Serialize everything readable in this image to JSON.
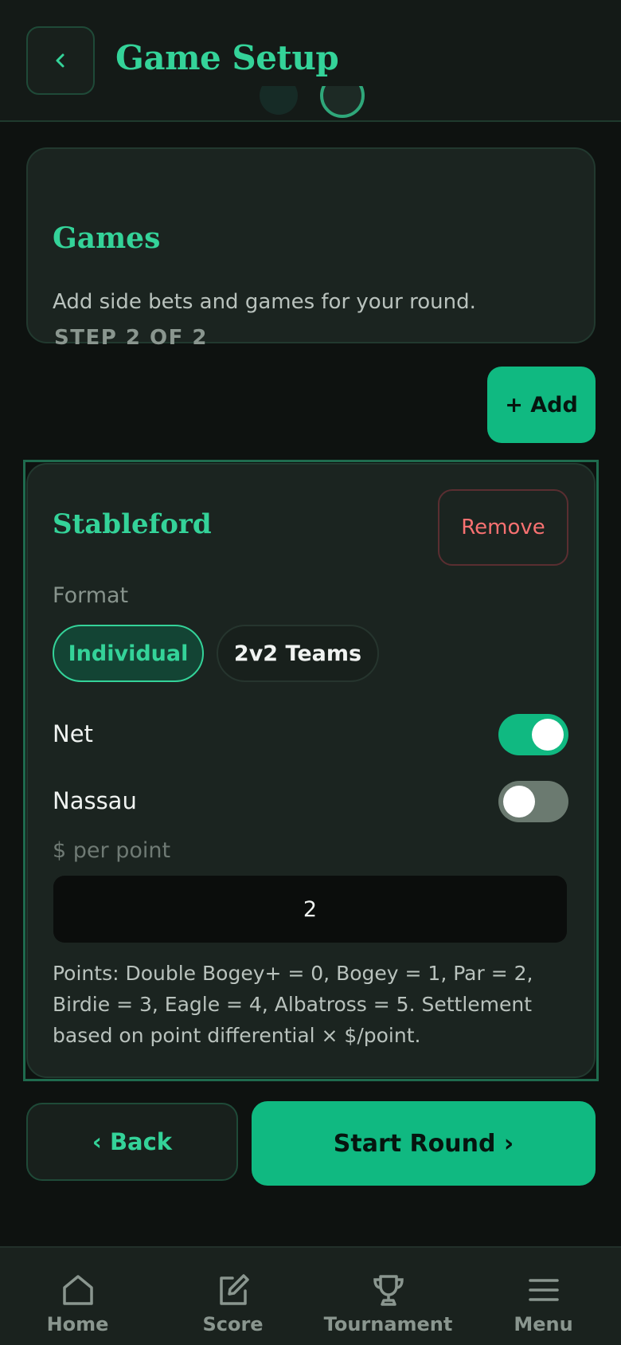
{
  "header": {
    "title": "Game Setup"
  },
  "step": {
    "label": "STEP 2 OF 2",
    "title": "Games",
    "description": "Add side bets and games for your round."
  },
  "add_button": "+ Add",
  "game": {
    "title": "Stableford",
    "remove_label": "Remove",
    "format_label": "Format",
    "format_options": [
      "Individual",
      "2v2 Teams"
    ],
    "format_selected": "Individual",
    "net_label": "Net",
    "net_on": true,
    "nassau_label": "Nassau",
    "nassau_on": false,
    "ppp_label": "$ per point",
    "ppp_value": "2",
    "points_note": "Points: Double Bogey+ = 0, Bogey = 1, Par = 2, Birdie = 3, Eagle = 4, Albatross = 5. Settlement based on point differential × $/point."
  },
  "actions": {
    "back_label": "‹ Back",
    "start_label": "Start Round ›"
  },
  "nav": [
    {
      "label": "Home",
      "icon": "home-icon"
    },
    {
      "label": "Score",
      "icon": "edit-icon"
    },
    {
      "label": "Tournament",
      "icon": "trophy-icon"
    },
    {
      "label": "Menu",
      "icon": "menu-icon"
    }
  ],
  "colors": {
    "accent": "#34d399",
    "button": "#10b981",
    "danger": "#f87171",
    "background": "#0e1210"
  }
}
